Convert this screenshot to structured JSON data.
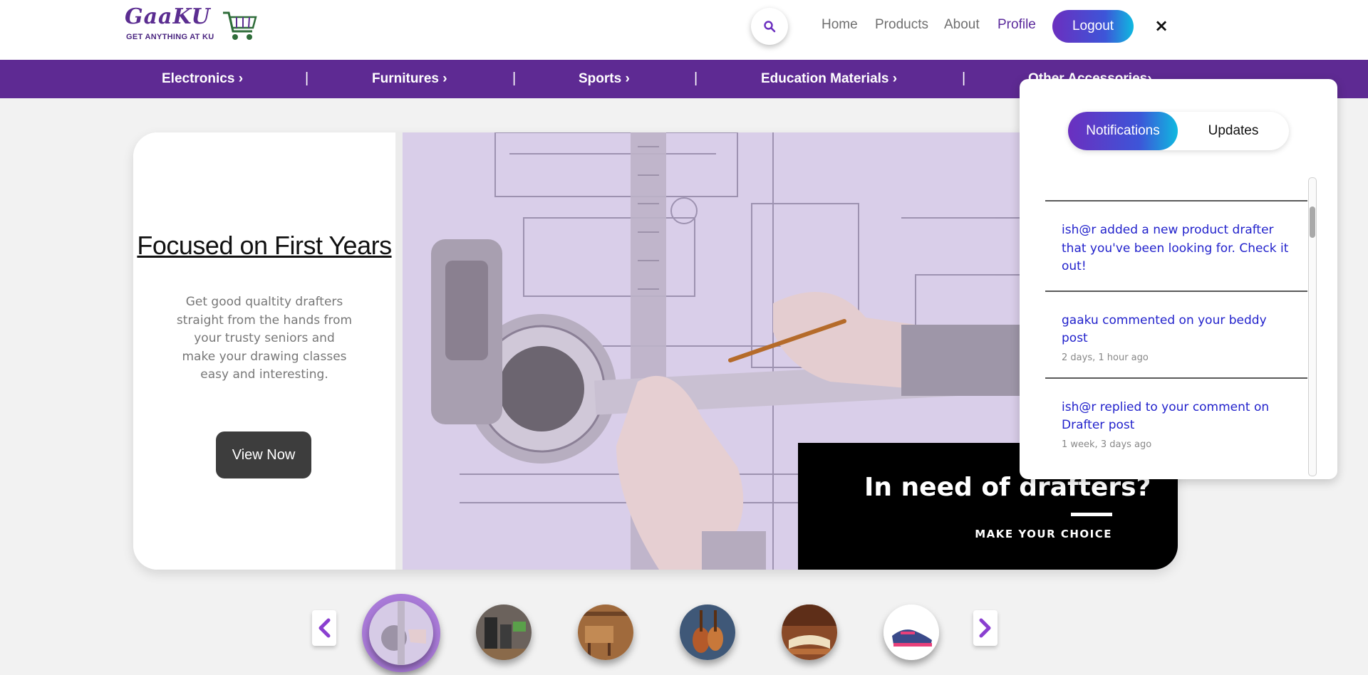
{
  "brand": {
    "logo_text": "GaaKU",
    "tagline": "GET ANYTHING AT KU"
  },
  "header": {
    "nav": [
      {
        "label": "Home"
      },
      {
        "label": "Products"
      },
      {
        "label": "About"
      },
      {
        "label": "Profile"
      }
    ],
    "logout_label": "Logout",
    "close_label": "×"
  },
  "categories": [
    {
      "label": "Electronics ›"
    },
    {
      "label": "Furnitures ›"
    },
    {
      "label": "Sports ›"
    },
    {
      "label": "Education Materials ›"
    },
    {
      "label": "Other Accessories›"
    }
  ],
  "separator": "|",
  "hero": {
    "title": "Focused on First Years",
    "description": "Get good qualtity drafters straight from the hands from your trusty seniors and make your drawing classes easy and interesting.",
    "button_label": "View Now",
    "banner_title": "In need of drafters?",
    "banner_subtitle": "MAKE YOUR CHOICE"
  },
  "carousel": {
    "thumbnails": [
      {
        "name": "drafter"
      },
      {
        "name": "electronics"
      },
      {
        "name": "furniture"
      },
      {
        "name": "instruments"
      },
      {
        "name": "books"
      },
      {
        "name": "shoes"
      }
    ]
  },
  "notifications_panel": {
    "tabs": [
      {
        "label": "Notifications",
        "active": true
      },
      {
        "label": "Updates",
        "active": false
      }
    ],
    "items": [
      {
        "text": "ish@r added a new product drafter that you've been looking for. Check it out!",
        "time": ""
      },
      {
        "text": "gaaku commented on your beddy post",
        "time": "2 days, 1 hour ago"
      },
      {
        "text": "ish@r replied to your comment on Drafter post",
        "time": "1 week, 3 days ago"
      }
    ]
  },
  "colors": {
    "brand_purple": "#5e2a93",
    "gradient_start": "#6b2fbf",
    "gradient_end": "#0fb9e0",
    "link_blue": "#2222cc",
    "button_dark": "#3d3d3d"
  }
}
